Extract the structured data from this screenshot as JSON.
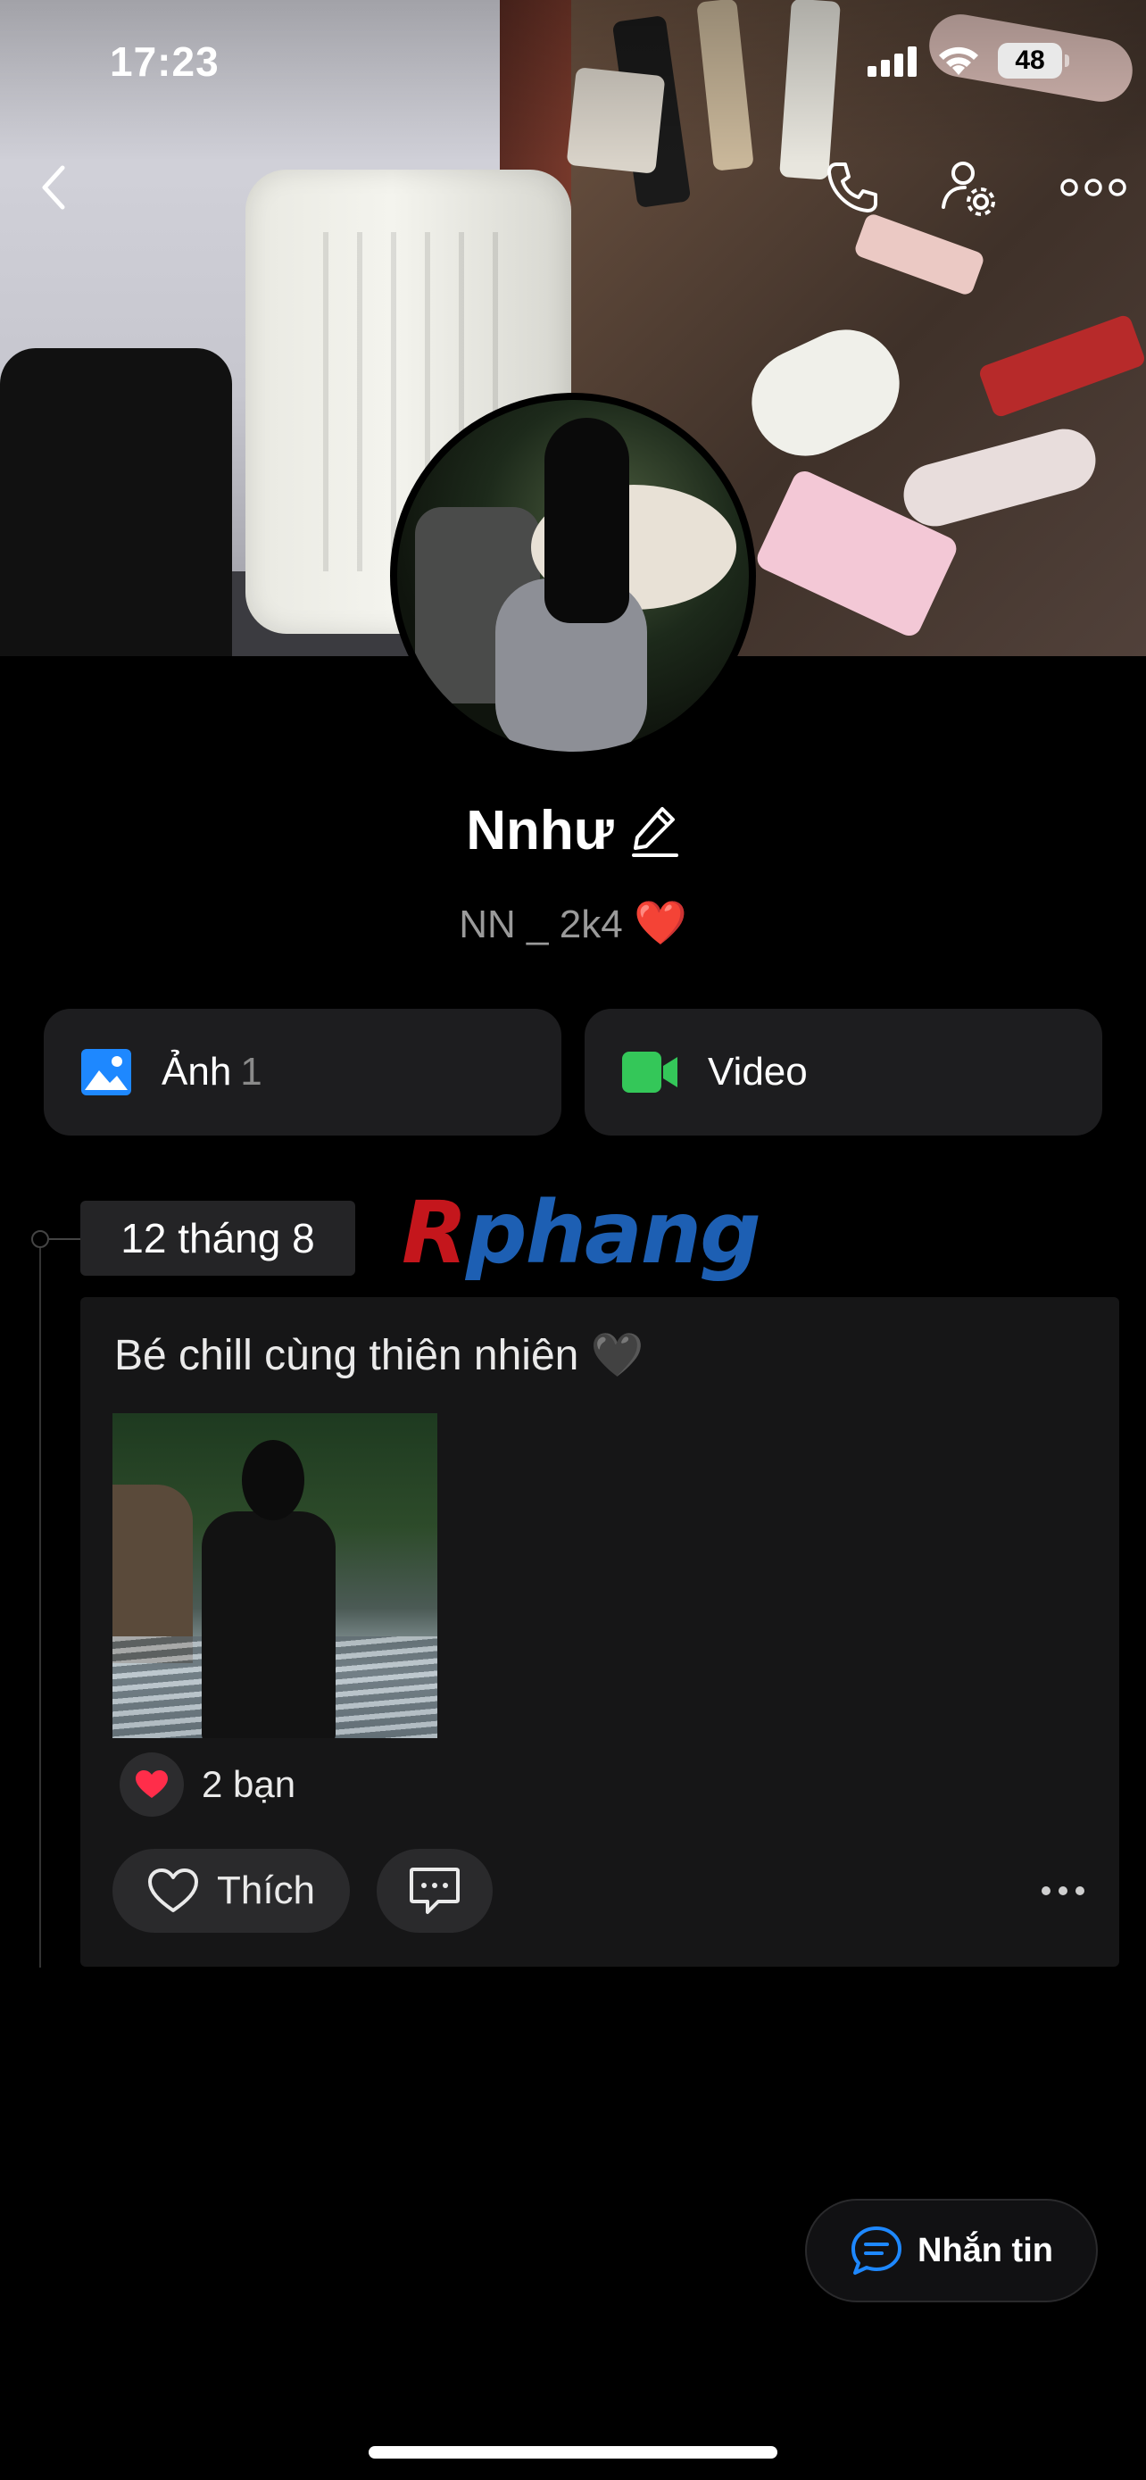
{
  "status_bar": {
    "time": "17:23",
    "battery": "48"
  },
  "profile": {
    "name": "Nnhư",
    "subtitle": "NN _ 2k4",
    "subtitle_emoji": "❤️"
  },
  "media": {
    "photos_label": "Ảnh",
    "photos_count": "1",
    "video_label": "Video"
  },
  "timeline": {
    "date": "12 tháng 8",
    "watermark": "Rphang"
  },
  "post": {
    "text": "Bé chill cùng thiên nhiên 🖤",
    "reaction_emoji": "❤️",
    "reaction_count": "2 bạn",
    "like_label": "Thích"
  },
  "fab": {
    "label": "Nhắn tin"
  },
  "colors": {
    "background": "#000000",
    "card": "#1d1d1f",
    "accent_blue": "#1e88ff",
    "video_green": "#34c759",
    "heart_red": "#ff2d4a"
  }
}
